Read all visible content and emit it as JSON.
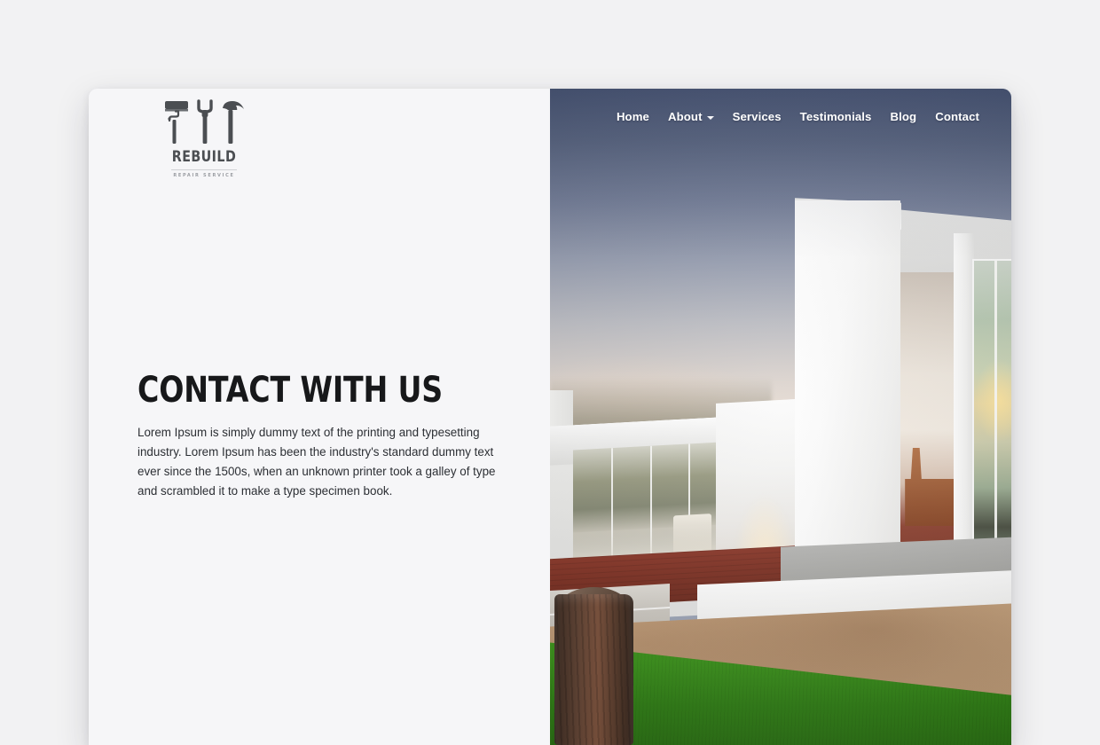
{
  "page": {
    "background_color": "#f2f2f3",
    "card_background": "#f6f6f8"
  },
  "brand": {
    "logo_icons": [
      "paint-roller-icon",
      "wrench-icon",
      "hammer-icon"
    ],
    "name": "REBUILD",
    "tagline": "REPAIR SERVICE",
    "name_color": "#4b4e52",
    "tagline_color": "#9b9ea3"
  },
  "nav": {
    "items": [
      {
        "label": "Home",
        "has_dropdown": false
      },
      {
        "label": "About",
        "has_dropdown": true
      },
      {
        "label": "Services",
        "has_dropdown": false
      },
      {
        "label": "Testimonials",
        "has_dropdown": false
      },
      {
        "label": "Blog",
        "has_dropdown": false
      },
      {
        "label": "Contact",
        "has_dropdown": false
      }
    ],
    "text_color": "#ffffff"
  },
  "hero": {
    "title": "CONTACT WITH US",
    "title_color": "#17181a",
    "paragraph": "Lorem Ipsum is simply dummy text of the printing and typesetting industry. Lorem Ipsum has been the industry's standard dummy text ever since the 1500s, when an unknown printer took a galley of type and scrambled it to make a type specimen book.",
    "paragraph_color": "#2c2f34"
  },
  "photo": {
    "alt": "Modern white minimalist house at dusk with wooden deck, concrete steps, grass lawn and tree stump",
    "sky_top_color": "#4a5777",
    "sky_horizon_color": "#fbf3ea",
    "deck_color": "#7d3326",
    "grass_color": "#3b8f1c",
    "dirt_color": "#c09f7c"
  }
}
